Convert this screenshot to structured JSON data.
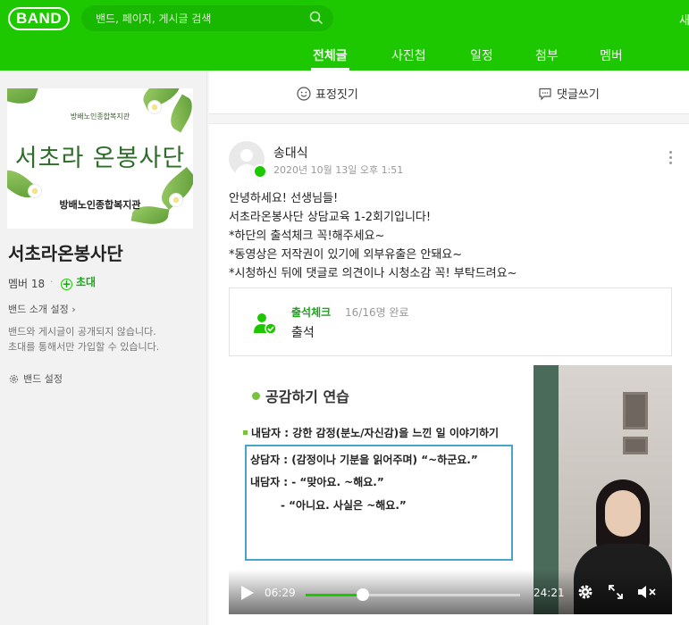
{
  "header": {
    "logo": "BAND",
    "search_placeholder": "밴드, 페이지, 게시글 검색",
    "right_text": "새"
  },
  "tabs": [
    {
      "label": "전체글",
      "active": true
    },
    {
      "label": "사진첩",
      "active": false
    },
    {
      "label": "일정",
      "active": false
    },
    {
      "label": "첨부",
      "active": false
    },
    {
      "label": "멤버",
      "active": false
    }
  ],
  "sidebar": {
    "cover": {
      "small_text": "방배노인종합복지관",
      "title": "서초라 온봉사단",
      "org": "방배노인종합복지관"
    },
    "band_name": "서초라온봉사단",
    "members": "멤버 18",
    "invite": "초대",
    "intro_setting": "밴드 소개 설정",
    "privacy_line1": "밴드와 게시글이 공개되지 않습니다.",
    "privacy_line2": "초대를 통해서만 가입할 수 있습니다.",
    "band_setting": "밴드 설정"
  },
  "actionbar": {
    "emoji": "표정짓기",
    "comment": "댓글쓰기"
  },
  "post": {
    "author": "송대식",
    "date": "2020년 10월 13일 오후 1:51",
    "lines": [
      "안녕하세요! 선생님들!",
      "서초라온봉사단 상담교육 1-2회기입니다!",
      "*하단의 출석체크 꼭!해주세요~",
      "*동영상은 저작권이 있기에 외부유출은 안돼요~",
      "*시청하신 뒤에 댓글로 의견이나 시청소감 꼭! 부탁드려요~"
    ],
    "attendance": {
      "title": "출석체크",
      "count": "16/16명 완료",
      "subtitle": "출석"
    },
    "video": {
      "slide_heading": "공감하기 연습",
      "slide_line1": "내담자 : 강한 감정(분노/자신감)을 느낀 일 이야기하기",
      "slide_box_lines": [
        "상담자 : (감정이나 기분을 읽어주며) “~하군요.”",
        "내담자 : - “맞아요. ~해요.”",
        "- “아니요. 사실은 ~해요.”"
      ],
      "current_time": "06:29",
      "total_time": "24:21",
      "progress": 0.266
    }
  },
  "colors": {
    "brand": "#1ec800",
    "brand_dark": "#19b800",
    "accent_text": "#1ea31e"
  }
}
